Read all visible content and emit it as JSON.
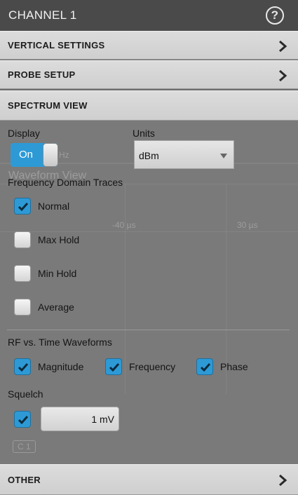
{
  "title": "CHANNEL 1",
  "help_icon": "help-icon",
  "sections": {
    "vertical_settings": "VERTICAL SETTINGS",
    "probe_setup": "PROBE SETUP",
    "spectrum_view": "SPECTRUM VIEW",
    "other": "OTHER"
  },
  "spectrum": {
    "display_label": "Display",
    "display_value": "On",
    "units_label": "Units",
    "units_value": "dBm",
    "fdt_label": "Frequency Domain Traces",
    "traces": [
      {
        "label": "Normal",
        "checked": true
      },
      {
        "label": "Max Hold",
        "checked": false
      },
      {
        "label": "Min Hold",
        "checked": false
      },
      {
        "label": "Average",
        "checked": false
      }
    ],
    "rf_label": "RF vs. Time Waveforms",
    "rf": [
      {
        "label": "Magnitude",
        "checked": true
      },
      {
        "label": "Frequency",
        "checked": true
      },
      {
        "label": "Phase",
        "checked": true
      }
    ],
    "squelch_label": "Squelch",
    "squelch_checked": true,
    "squelch_value": "1 mV"
  },
  "background": {
    "waveform_view": "Waveform View",
    "tick1": "-40 µs",
    "tick2": "30 µs",
    "hz": "Hz",
    "c1": "C 1"
  },
  "colors": {
    "accent": "#2d9ad6",
    "title_bar": "#4a4a4a",
    "panel": "#7a7a7a"
  }
}
